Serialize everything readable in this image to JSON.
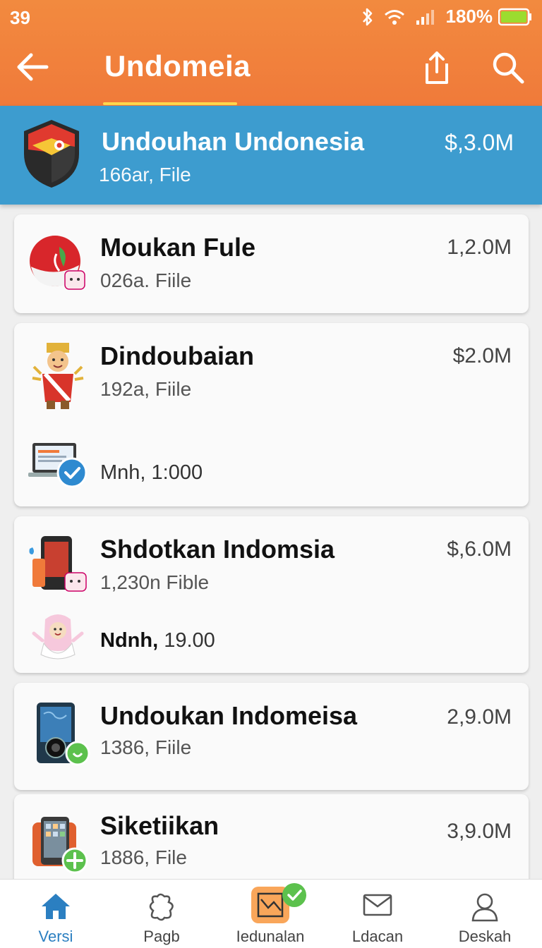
{
  "status_bar": {
    "time": "39",
    "battery": "180%"
  },
  "app_bar": {
    "title": "Undomeia"
  },
  "header_item": {
    "name": "Undouhan Undonesia",
    "sub": "166ar, File",
    "size": "$,3.0M"
  },
  "items": [
    {
      "name": "Moukan Fule",
      "sub": "026a. Fiile",
      "size": "1,2.0M"
    },
    {
      "name": "Dindoubaian",
      "sub": "192a, Fiile",
      "size": "$2.0M",
      "meta": "Mnh, 1:000"
    },
    {
      "name": "Shdotkan Indomsia",
      "sub": "1,230n Fible",
      "size": "$,6.0M",
      "meta_bold": "Ndnh,",
      "meta": "19.00"
    },
    {
      "name": "Undoukan Indomeisa",
      "sub": "1386, Fiile",
      "size": "2,9.0M"
    },
    {
      "name": "Siketiikan",
      "sub": "1886, File",
      "size": "3,9.0M"
    }
  ],
  "bottom_nav": [
    {
      "label": "Versi",
      "icon": "home-icon",
      "active": true
    },
    {
      "label": "Pagb",
      "icon": "puzzle-icon",
      "active": false
    },
    {
      "label": "Iedunalan",
      "icon": "chart-icon",
      "active": false
    },
    {
      "label": "Ldacan",
      "icon": "mail-icon",
      "active": false
    },
    {
      "label": "Deskah",
      "icon": "person-icon",
      "active": false
    }
  ],
  "colors": {
    "appbar": "#f07a3a",
    "header": "#3d9ccf",
    "active_nav": "#2b7fc1",
    "badge_green": "#5cc14d"
  }
}
